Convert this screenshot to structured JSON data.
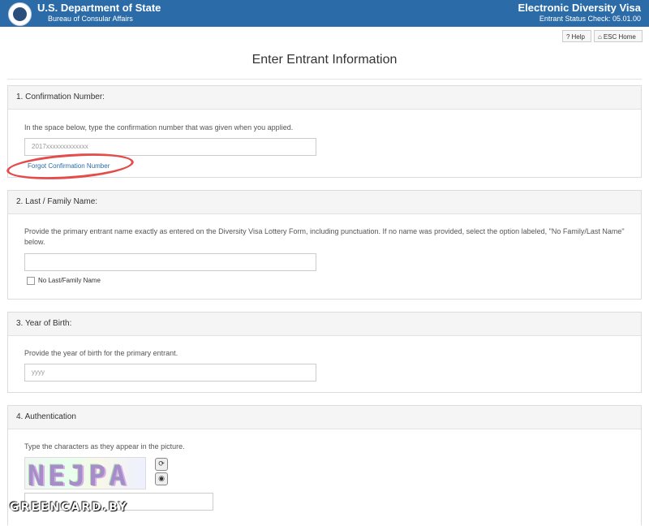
{
  "header": {
    "org_title": "U.S. Department of State",
    "org_subtitle": "Bureau of Consular Affairs",
    "app_title": "Electronic Diversity Visa",
    "app_subtitle": "Entrant Status Check: 05.01.00",
    "seal_icon": "seal-icon",
    "colors": {
      "bar": "#2b6ca8"
    }
  },
  "toolbar": {
    "help_label": "Help",
    "home_label": "ESC Home"
  },
  "page": {
    "title": "Enter Entrant Information"
  },
  "sections": [
    {
      "title": "1. Confirmation Number:",
      "instruction": "In the space below, type the confirmation number that was given when you applied.",
      "input_placeholder": "2017xxxxxxxxxxxxx",
      "link": "Forgot Confirmation Number"
    },
    {
      "title": "2. Last / Family Name:",
      "instruction": "Provide the primary entrant name exactly as entered on the Diversity Visa Lottery Form, including punctuation. If no name was provided, select the option labeled, \"No Family/Last Name\" below.",
      "input_placeholder": "",
      "checkbox_label": "No Last/Family Name"
    },
    {
      "title": "3. Year of Birth:",
      "instruction": "Provide the year of birth for the primary entrant.",
      "input_placeholder": "yyyy"
    },
    {
      "title": "4. Authentication",
      "instruction": "Type the characters as they appear in the picture.",
      "captcha_text": "NEJPA",
      "input_placeholder": ""
    }
  ],
  "watermark": "GREENCARD.BY"
}
